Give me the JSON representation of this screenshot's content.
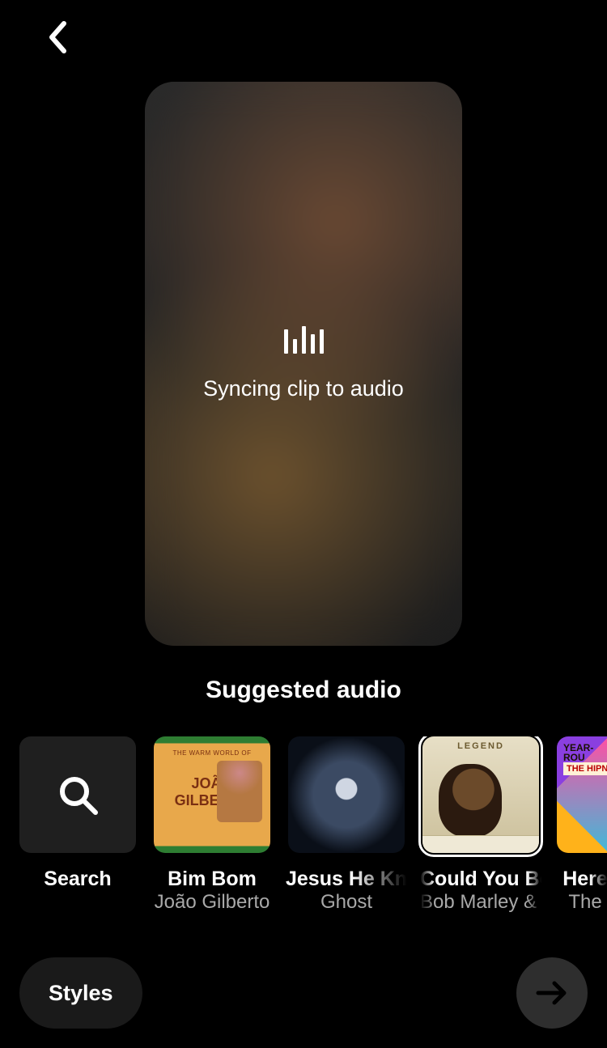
{
  "preview": {
    "status_text": "Syncing clip to audio"
  },
  "suggested": {
    "heading": "Suggested audio",
    "search_label": "Search",
    "items": [
      {
        "title": "Bim Bom",
        "artist": "João Gilberto",
        "selected": false
      },
      {
        "title": "Jesus He Knows Me",
        "artist": "Ghost",
        "selected": false
      },
      {
        "title": "Could You Be Loved",
        "artist": "Bob Marley & The Wailers",
        "selected": true
      },
      {
        "title": "Here",
        "artist": "The",
        "selected": false
      }
    ]
  },
  "bottom": {
    "styles_label": "Styles"
  },
  "album_text": {
    "gilberto_top": "THE WARM WORLD OF",
    "gilberto_name": "JOÃO\nGILBERTO",
    "marley_top": "LEGEND",
    "here_top": "YEAR-ROU",
    "here_box": "THE HIPN"
  }
}
